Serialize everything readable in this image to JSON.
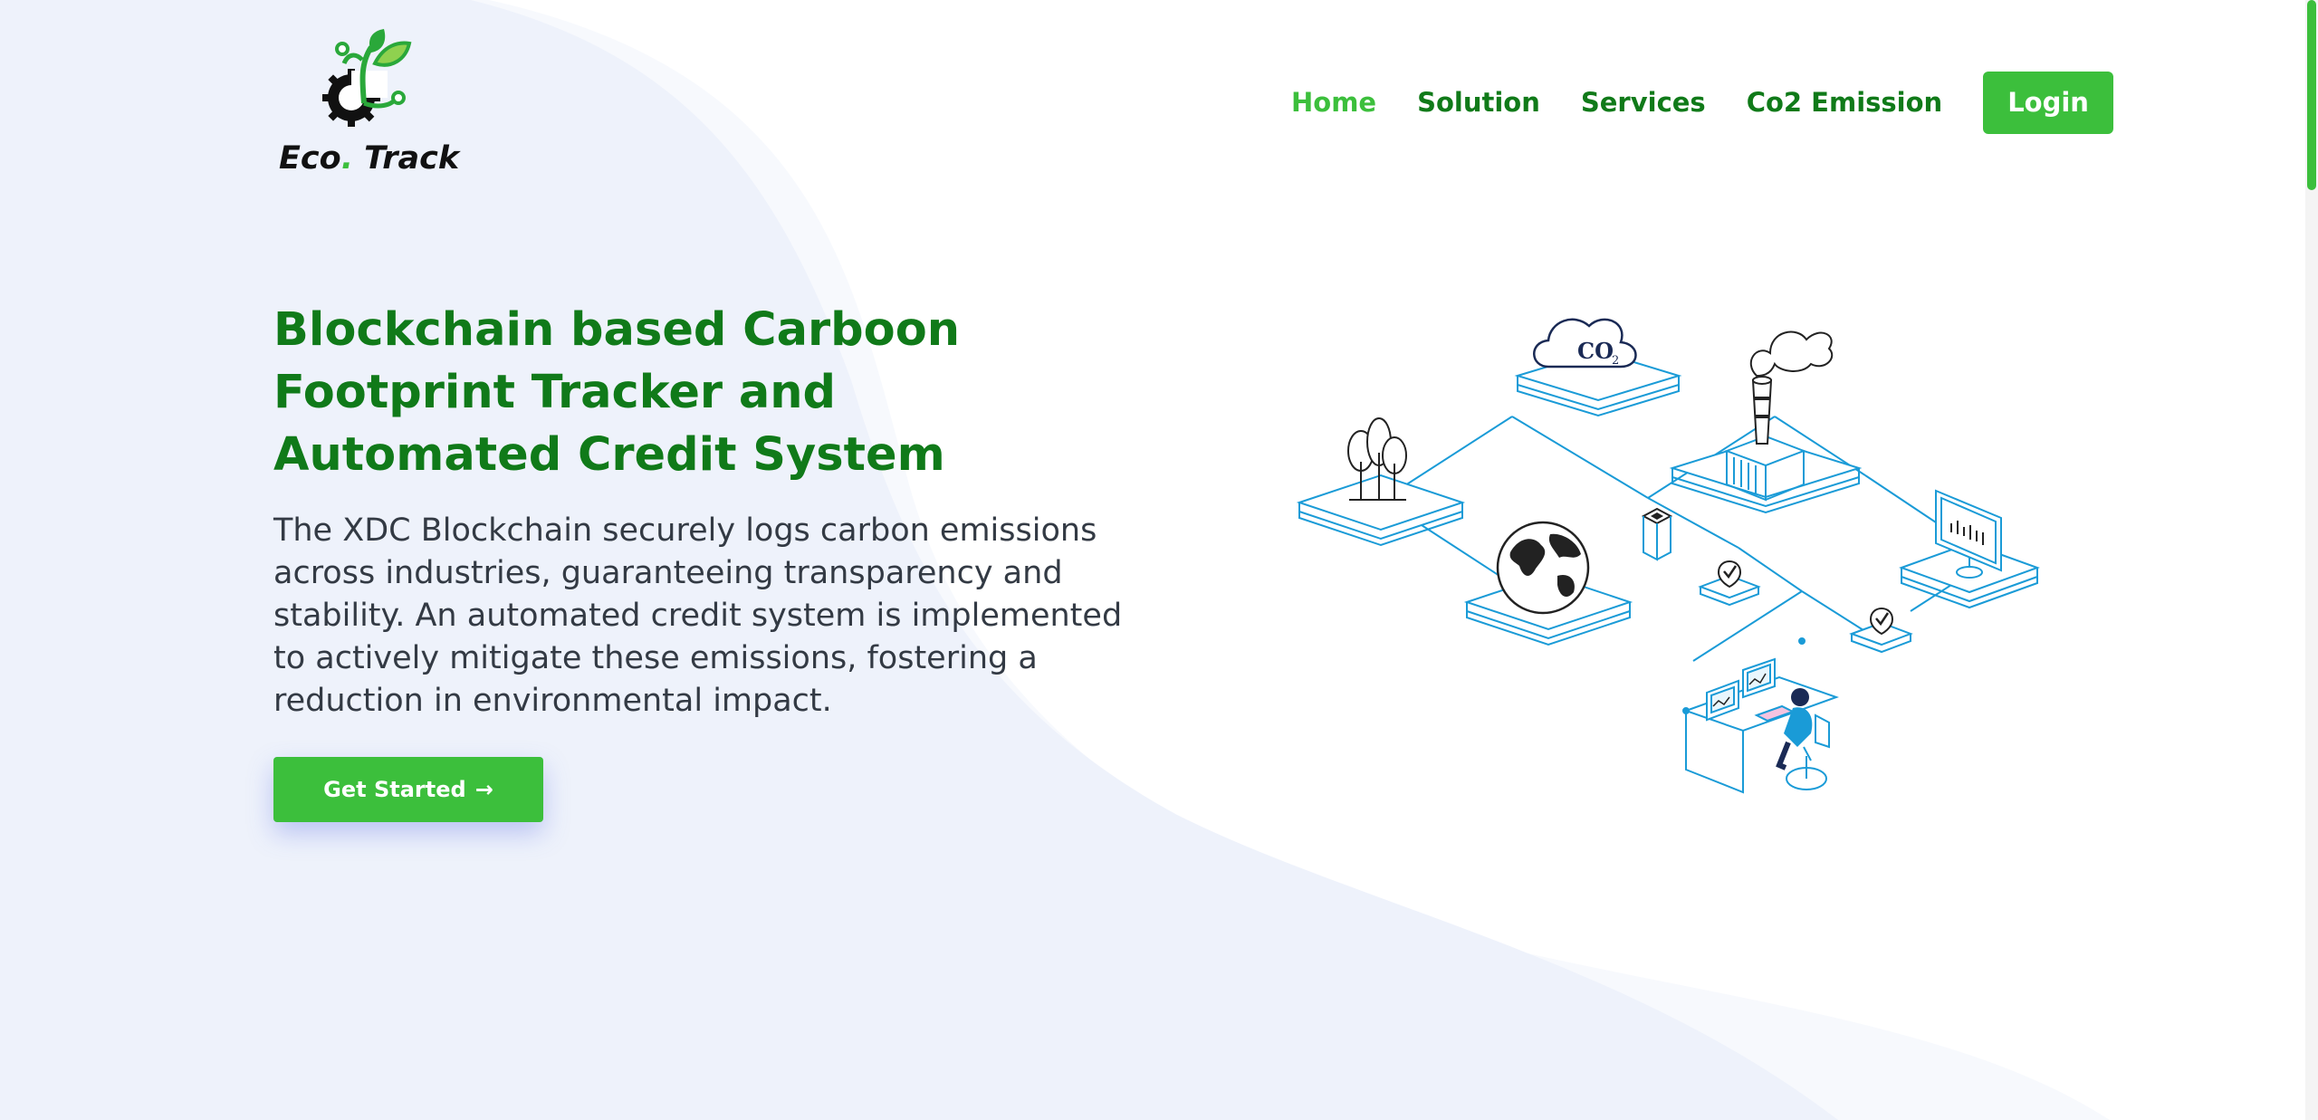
{
  "colors": {
    "brand_green": "#3cbf3c",
    "dark_green": "#107a19",
    "wave_bg": "#eef2fb",
    "line_blue": "#1a9bd7"
  },
  "logo": {
    "brand_first": "Eco",
    "brand_dot": ".",
    "brand_second": " Track",
    "icon": "leaf-gear-icon"
  },
  "nav": {
    "items": [
      {
        "label": "Home",
        "active": true
      },
      {
        "label": "Solution",
        "active": false
      },
      {
        "label": "Services",
        "active": false
      },
      {
        "label": "Co2 Emission",
        "active": false
      }
    ],
    "login_label": "Login"
  },
  "hero": {
    "title": "Blockchain based Carboon Footprint Tracker and Automated Credit System",
    "description": "The XDC Blockchain securely logs carbon emissions across industries, guaranteeing transparency and stability. An automated credit system is implemented to actively mitigate these emissions, fostering a reduction in environmental impact.",
    "cta_label": "Get Started",
    "cta_icon": "arrow-right-icon"
  },
  "illustration": {
    "cloud_text": "CO",
    "cloud_subscript": "2",
    "icons": [
      "co2-cloud-icon",
      "trees-icon",
      "factory-icon",
      "globe-icon",
      "server-icon",
      "shield-check-icon",
      "monitor-chart-icon",
      "developer-workstation-icon"
    ]
  }
}
